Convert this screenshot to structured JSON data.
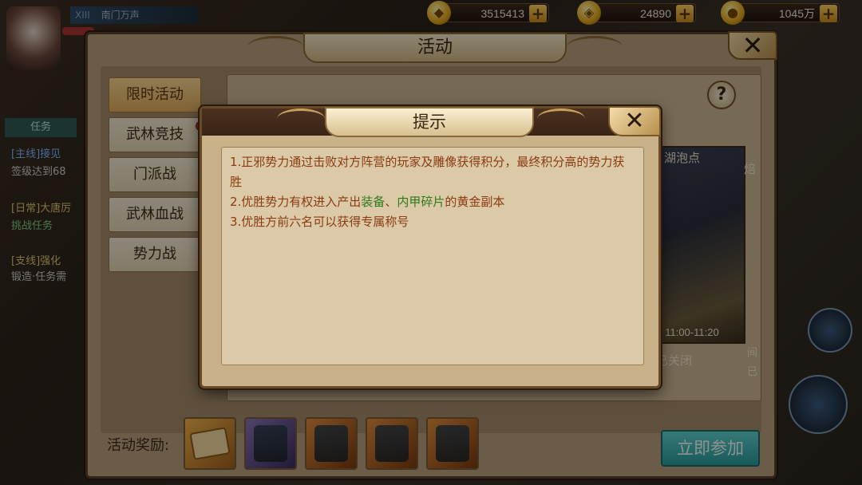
{
  "hud": {
    "player_name": "南门万声",
    "player_level_tag": "XIII",
    "currencies": [
      {
        "icon": "gold-ingot-icon",
        "value": "3515413"
      },
      {
        "icon": "bound-gold-ingot-icon",
        "value": "24890"
      },
      {
        "icon": "coin-icon",
        "value": "1045万"
      }
    ],
    "left_snippets": [
      "任务",
      "[主线]接见",
      "签级达到68",
      "[日常]大唐厉",
      "挑战任务",
      "[支线]强化",
      "锻造·任务需"
    ]
  },
  "activity_window": {
    "title": "活动",
    "tabs": [
      {
        "label": "限时活动",
        "active": true,
        "badge": false
      },
      {
        "label": "武林竞技",
        "active": false,
        "badge": true
      },
      {
        "label": "门派战",
        "active": false,
        "badge": false
      },
      {
        "label": "武林血战",
        "active": false,
        "badge": false
      },
      {
        "label": "势力战",
        "active": false,
        "badge": false
      }
    ],
    "help_label": "?",
    "preview": {
      "title": "湖泡点",
      "title_suffix": "焙",
      "time": ": 11:00-11:20",
      "status": "已关闭",
      "time_suffix": "间",
      "status_suffix": "已"
    },
    "reward_label": "活动奖励:",
    "rewards": [
      "scroll-reward-icon",
      "purple-armor-reward-icon",
      "teal-armor-reward-icon",
      "bronze-armor-reward-icon",
      "dark-pants-reward-icon"
    ],
    "join_button": "立即参加"
  },
  "tip_dialog": {
    "title": "提示",
    "close_label": "✕",
    "lines": [
      {
        "parts": [
          {
            "text": "1.正邪势力通过击败对方阵营的玩家及雕像获得积分，最终积分高的势力获胜",
            "highlight": false
          }
        ]
      },
      {
        "parts": [
          {
            "text": "2.优胜势力有权进入产出",
            "highlight": false
          },
          {
            "text": "装备",
            "highlight": true
          },
          {
            "text": "、",
            "highlight": false
          },
          {
            "text": "内甲碎片",
            "highlight": true
          },
          {
            "text": "的黄金副本",
            "highlight": false
          }
        ]
      },
      {
        "parts": [
          {
            "text": "3.优胜方前六名可以获得专属称号",
            "highlight": false
          }
        ]
      }
    ]
  }
}
